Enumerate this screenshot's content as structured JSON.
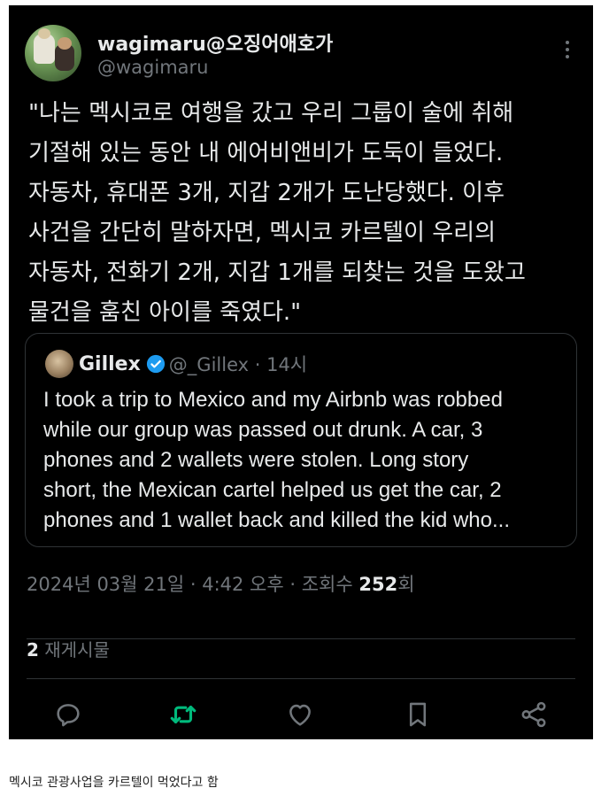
{
  "tweet": {
    "display_name": "wagimaru@오징어애호가",
    "handle": "@wagimaru",
    "text": "\"나는 멕시코로 여행을 갔고 우리 그룹이 술에 취해\n기절해 있는 동안 내 에어비앤비가 도둑이 들었다.\n자동차, 휴대폰 3개, 지갑 2개가 도난당했다. 이후\n사건을 간단히 말하자면, 멕시코 카르텔이 우리의\n자동차, 전화기 2개, 지갑 1개를 되찾는 것을 도왔고\n물건을 훔친 아이를 죽였다.\"",
    "timestamp": "2024년 03월 21일 · 4:42 오후 · 조회수 ",
    "views": "252",
    "views_suffix": "회",
    "repost_count": "2",
    "repost_label": " 재게시물"
  },
  "quote": {
    "name": "Gillex",
    "meta": "@_Gillex · 14시",
    "text": "I took a trip to Mexico and my Airbnb was robbed\nwhile our group was passed out drunk. A car, 3\nphones and 2 wallets were stolen. Long story\nshort, the Mexican cartel helped us get the car, 2\nphones and 1 wallet back and killed the kid who..."
  },
  "actions": [
    "reply-icon",
    "repost-icon",
    "like-icon",
    "bookmark-icon",
    "share-icon"
  ],
  "colors": {
    "background": "#000000",
    "text": "#e7e9ea",
    "muted": "#71767b",
    "repost_green": "#00ba7c",
    "verified_blue": "#1d9bf0"
  },
  "caption": "멕시코 관광사업을 카르텔이 먹었다고 함"
}
